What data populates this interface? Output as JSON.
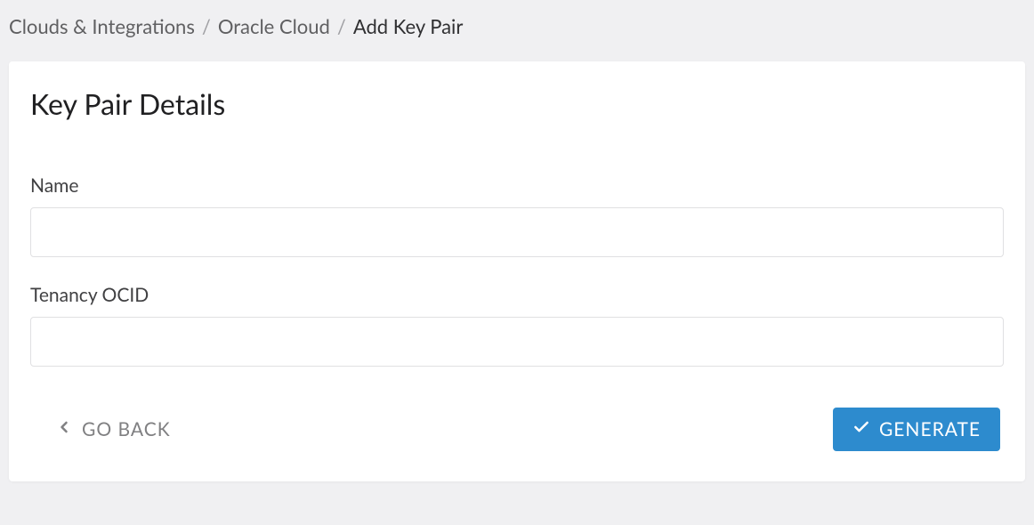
{
  "breadcrumb": {
    "items": [
      {
        "label": "Clouds & Integrations"
      },
      {
        "label": "Oracle Cloud"
      }
    ],
    "current": "Add Key Pair",
    "separator": "/"
  },
  "card": {
    "title": "Key Pair Details"
  },
  "form": {
    "name": {
      "label": "Name",
      "value": ""
    },
    "tenancy_ocid": {
      "label": "Tenancy OCID",
      "value": ""
    }
  },
  "buttons": {
    "back": "GO BACK",
    "generate": "GENERATE"
  },
  "colors": {
    "primary": "#2d8bce"
  }
}
